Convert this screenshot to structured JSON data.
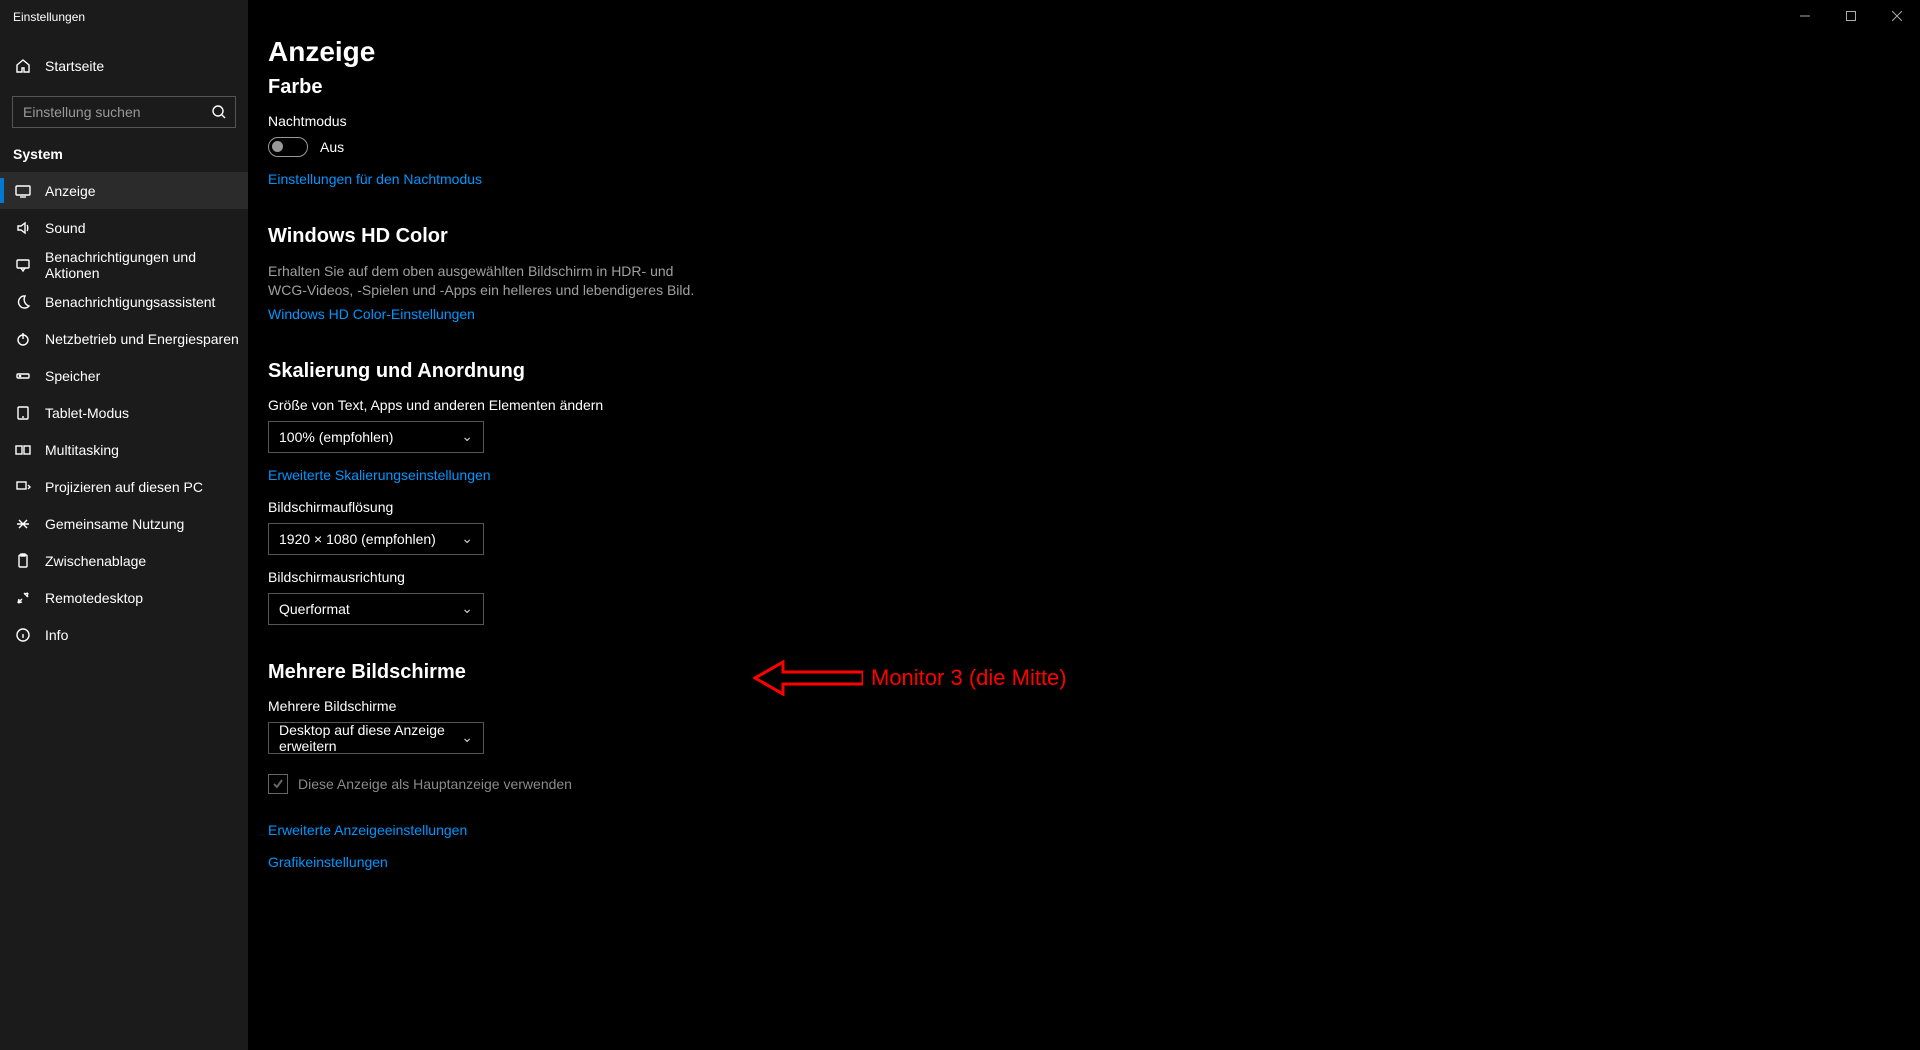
{
  "window": {
    "title": "Einstellungen"
  },
  "sidebar": {
    "home": "Startseite",
    "search_placeholder": "Einstellung suchen",
    "section": "System",
    "items": [
      {
        "label": "Anzeige",
        "active": true
      },
      {
        "label": "Sound"
      },
      {
        "label": "Benachrichtigungen und Aktionen"
      },
      {
        "label": "Benachrichtigungsassistent"
      },
      {
        "label": "Netzbetrieb und Energiesparen"
      },
      {
        "label": "Speicher"
      },
      {
        "label": "Tablet-Modus"
      },
      {
        "label": "Multitasking"
      },
      {
        "label": "Projizieren auf diesen PC"
      },
      {
        "label": "Gemeinsame Nutzung"
      },
      {
        "label": "Zwischenablage"
      },
      {
        "label": "Remotedesktop"
      },
      {
        "label": "Info"
      }
    ]
  },
  "page": {
    "title": "Anzeige",
    "color": {
      "heading": "Farbe",
      "nightmode_label": "Nachtmodus",
      "nightmode_state": "Aus",
      "nightmode_link": "Einstellungen für den Nachtmodus"
    },
    "hd": {
      "heading": "Windows HD Color",
      "desc": "Erhalten Sie auf dem oben ausgewählten Bildschirm in HDR- und WCG-Videos, -Spielen und -Apps ein helleres und lebendigeres Bild.",
      "link": "Windows HD Color-Einstellungen"
    },
    "scale": {
      "heading": "Skalierung und Anordnung",
      "size_label": "Größe von Text, Apps und anderen Elementen ändern",
      "size_value": "100% (empfohlen)",
      "adv_link": "Erweiterte Skalierungseinstellungen",
      "res_label": "Bildschirmauflösung",
      "res_value": "1920 × 1080 (empfohlen)",
      "orient_label": "Bildschirmausrichtung",
      "orient_value": "Querformat"
    },
    "multi": {
      "heading": "Mehrere Bildschirme",
      "label": "Mehrere Bildschirme",
      "value": "Desktop auf diese Anzeige erweitern",
      "checkbox": "Diese Anzeige als Hauptanzeige verwenden",
      "adv_link": "Erweiterte Anzeigeeinstellungen",
      "gfx_link": "Grafikeinstellungen"
    }
  },
  "annotation": {
    "text": "Monitor 3 (die Mitte)"
  }
}
